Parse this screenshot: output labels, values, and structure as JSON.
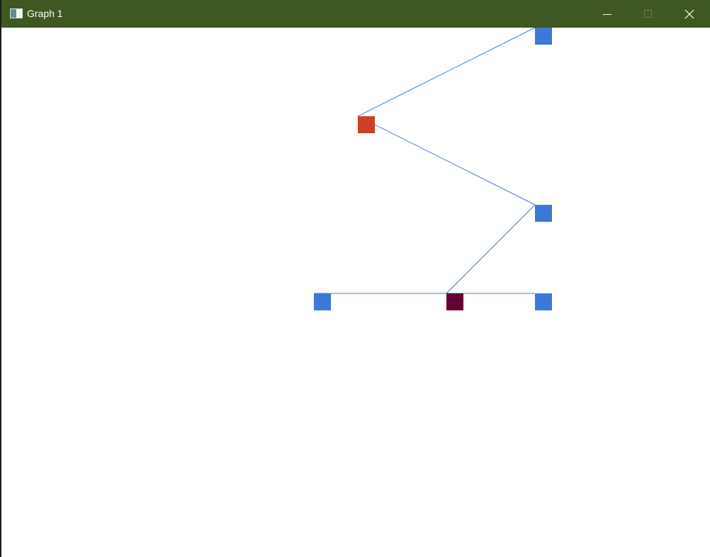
{
  "window": {
    "title": "Graph 1",
    "titlebar_color": "#3f5720",
    "canvas_color": "#ffffff"
  },
  "icons": {
    "app": "app-window-icon",
    "minimize": "minimize-icon",
    "maximize": "maximize-icon",
    "close": "close-icon"
  },
  "graph": {
    "edge_color": "#3c78d8",
    "nodes": [
      {
        "id": "n1",
        "color": "#3c78d8"
      },
      {
        "id": "n2",
        "color": "#cc4125"
      },
      {
        "id": "n3",
        "color": "#3c78d8"
      },
      {
        "id": "n4",
        "color": "#3c78d8"
      },
      {
        "id": "n5",
        "color": "#660033"
      },
      {
        "id": "n6",
        "color": "#3c78d8"
      }
    ],
    "edges": [
      {
        "from": "n2",
        "to": "n1"
      },
      {
        "from": "n2",
        "to": "n3"
      },
      {
        "from": "n5",
        "to": "n3"
      },
      {
        "from": "n4",
        "to": "n6"
      }
    ]
  }
}
